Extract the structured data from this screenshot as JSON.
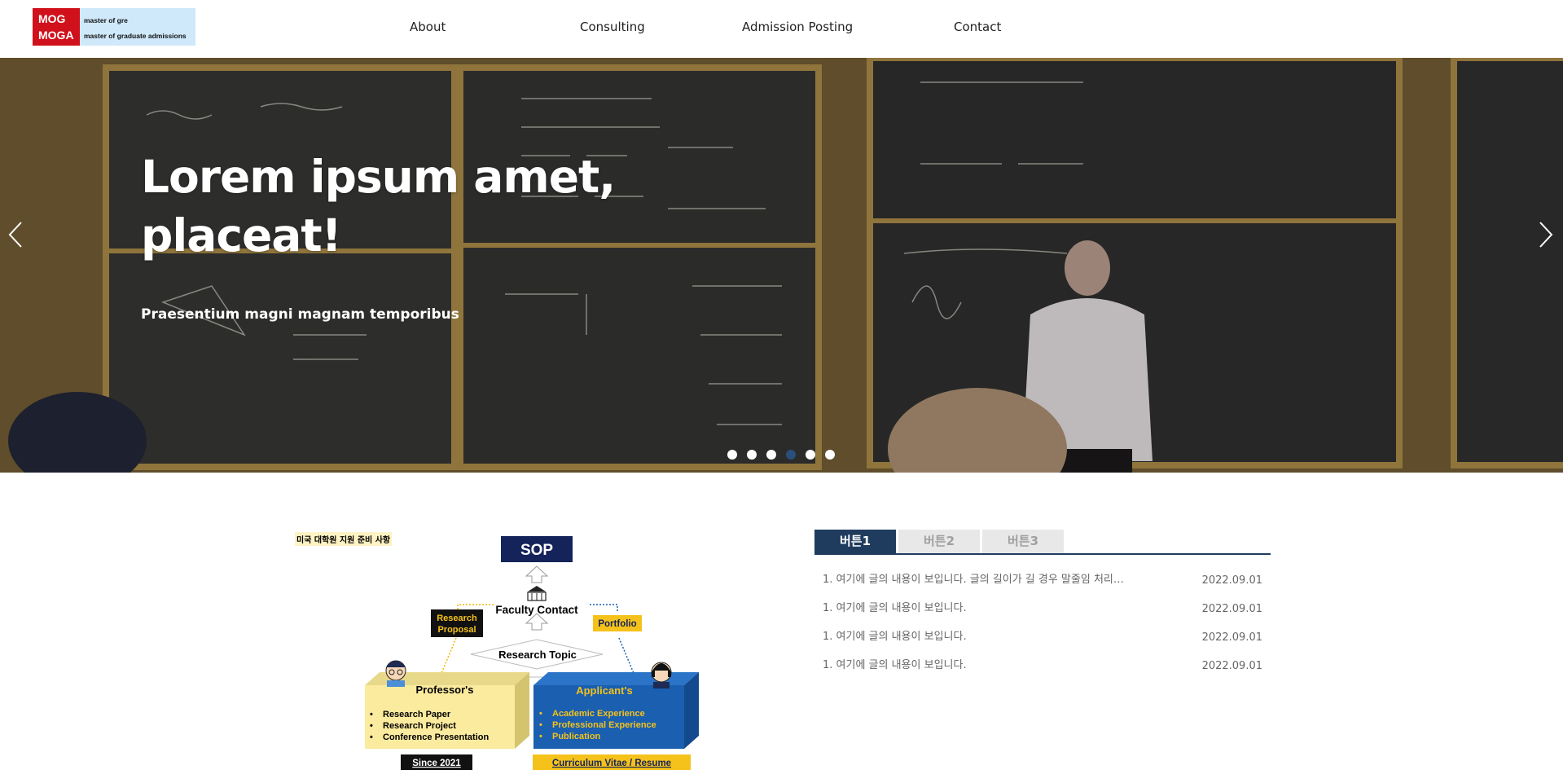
{
  "header": {
    "logo": {
      "red_line1": "MOG",
      "red_line2": "MOGA",
      "line1": "master of gre",
      "line2": "master of graduate admissions"
    },
    "nav": [
      {
        "label": "About"
      },
      {
        "label": "Consulting"
      },
      {
        "label": "Admission Posting"
      },
      {
        "label": "Contact"
      }
    ]
  },
  "hero": {
    "title": "Lorem ipsum amet, placeat!",
    "subtitle": "Praesentium magni magnam temporibus",
    "slides_total": 6,
    "active_slide": 4,
    "prev_icon": "chevron-left-icon",
    "next_icon": "chevron-right-icon"
  },
  "diagram": {
    "caption": "미국 대학원 지원 준비 사항",
    "sop": "SOP",
    "faculty_contact": "Faculty Contact",
    "research_proposal_1": "Research",
    "research_proposal_2": "Proposal",
    "portfolio": "Portfolio",
    "research_topic": "Research Topic",
    "professor_title": "Professor's",
    "professor_items": [
      "Research Paper",
      "Research Project",
      "Conference Presentation"
    ],
    "applicant_title": "Applicant's",
    "applicant_items": [
      "Academic Experience",
      "Professional Experience",
      "Publication"
    ],
    "since": "Since 2021",
    "cv": "Curriculum Vitae / Resume",
    "colors": {
      "navy": "#14235a",
      "yellow": "#fbeb9e",
      "blue": "#1a5fb0",
      "gold": "#f5c21b"
    }
  },
  "board": {
    "tabs": [
      {
        "label": "버튼1"
      },
      {
        "label": "버튼2"
      },
      {
        "label": "버튼3"
      }
    ],
    "active_tab": 0,
    "rows": [
      {
        "title": "1. 여기에 글의 내용이 보입니다. 글의 길이가 길 경우 말줄임 처리…",
        "date": "2022.09.01"
      },
      {
        "title": "1. 여기에 글의 내용이 보입니다.",
        "date": "2022.09.01"
      },
      {
        "title": "1. 여기에 글의 내용이 보입니다.",
        "date": "2022.09.01"
      },
      {
        "title": "1. 여기에 글의 내용이 보입니다.",
        "date": "2022.09.01"
      }
    ]
  }
}
